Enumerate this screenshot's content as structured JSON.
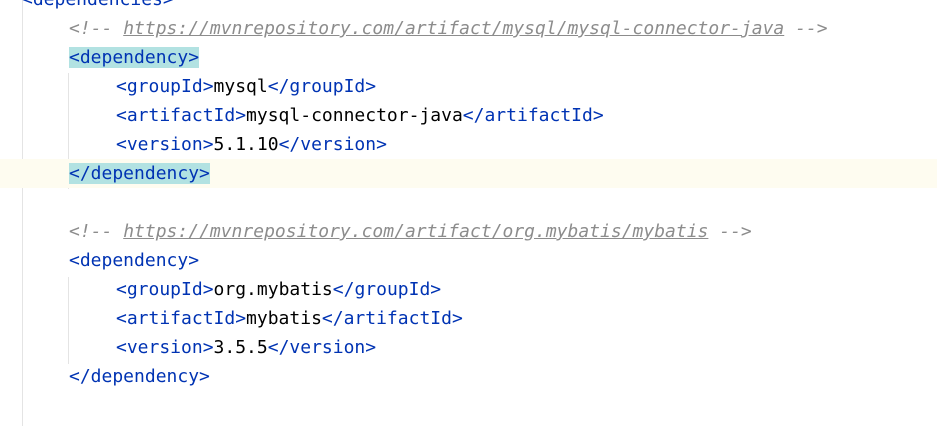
{
  "editor": {
    "lines": [
      {
        "indent": 0,
        "tokens": [
          {
            "t": "tag",
            "v": "<dependencies>"
          }
        ]
      },
      {
        "indent": 1,
        "tokens": [
          {
            "t": "comment",
            "v": "<!-- "
          },
          {
            "t": "link",
            "v": "https://mvnrepository.com/artifact/mysql/mysql-connector-java"
          },
          {
            "t": "comment",
            "v": " -->"
          }
        ]
      },
      {
        "indent": 1,
        "tokens": [
          {
            "t": "tag",
            "v": "<dependency>",
            "hl": true
          }
        ]
      },
      {
        "indent": 2,
        "tokens": [
          {
            "t": "tag",
            "v": "<groupId>"
          },
          {
            "t": "text",
            "v": "mysql"
          },
          {
            "t": "tag",
            "v": "</groupId>"
          }
        ]
      },
      {
        "indent": 2,
        "tokens": [
          {
            "t": "tag",
            "v": "<artifactId>"
          },
          {
            "t": "text",
            "v": "mysql-connector-java"
          },
          {
            "t": "tag",
            "v": "</artifactId>"
          }
        ]
      },
      {
        "indent": 2,
        "tokens": [
          {
            "t": "tag",
            "v": "<version>"
          },
          {
            "t": "text",
            "v": "5.1.10"
          },
          {
            "t": "tag",
            "v": "</version>"
          }
        ]
      },
      {
        "indent": 1,
        "current": true,
        "tokens": [
          {
            "t": "tag",
            "v": "</dependency>",
            "hl": true
          }
        ]
      },
      {
        "indent": 0,
        "tokens": []
      },
      {
        "indent": 1,
        "tokens": [
          {
            "t": "comment",
            "v": "<!-- "
          },
          {
            "t": "link",
            "v": "https://mvnrepository.com/artifact/org.mybatis/mybatis"
          },
          {
            "t": "comment",
            "v": " -->"
          }
        ]
      },
      {
        "indent": 1,
        "tokens": [
          {
            "t": "tag",
            "v": "<dependency>"
          }
        ]
      },
      {
        "indent": 2,
        "tokens": [
          {
            "t": "tag",
            "v": "<groupId>"
          },
          {
            "t": "text",
            "v": "org.mybatis"
          },
          {
            "t": "tag",
            "v": "</groupId>"
          }
        ]
      },
      {
        "indent": 2,
        "tokens": [
          {
            "t": "tag",
            "v": "<artifactId>"
          },
          {
            "t": "text",
            "v": "mybatis"
          },
          {
            "t": "tag",
            "v": "</artifactId>"
          }
        ]
      },
      {
        "indent": 2,
        "tokens": [
          {
            "t": "tag",
            "v": "<version>"
          },
          {
            "t": "text",
            "v": "3.5.5"
          },
          {
            "t": "tag",
            "v": "</version>"
          }
        ]
      },
      {
        "indent": 1,
        "tokens": [
          {
            "t": "tag",
            "v": "</dependency>"
          }
        ]
      }
    ],
    "colors": {
      "tag": "#0033b3",
      "comment": "#8c8c8c",
      "text": "#000000",
      "brace_highlight": "#b2e2e2",
      "current_line": "#fefcf0",
      "indent_guide": "#e4e4e4"
    }
  }
}
